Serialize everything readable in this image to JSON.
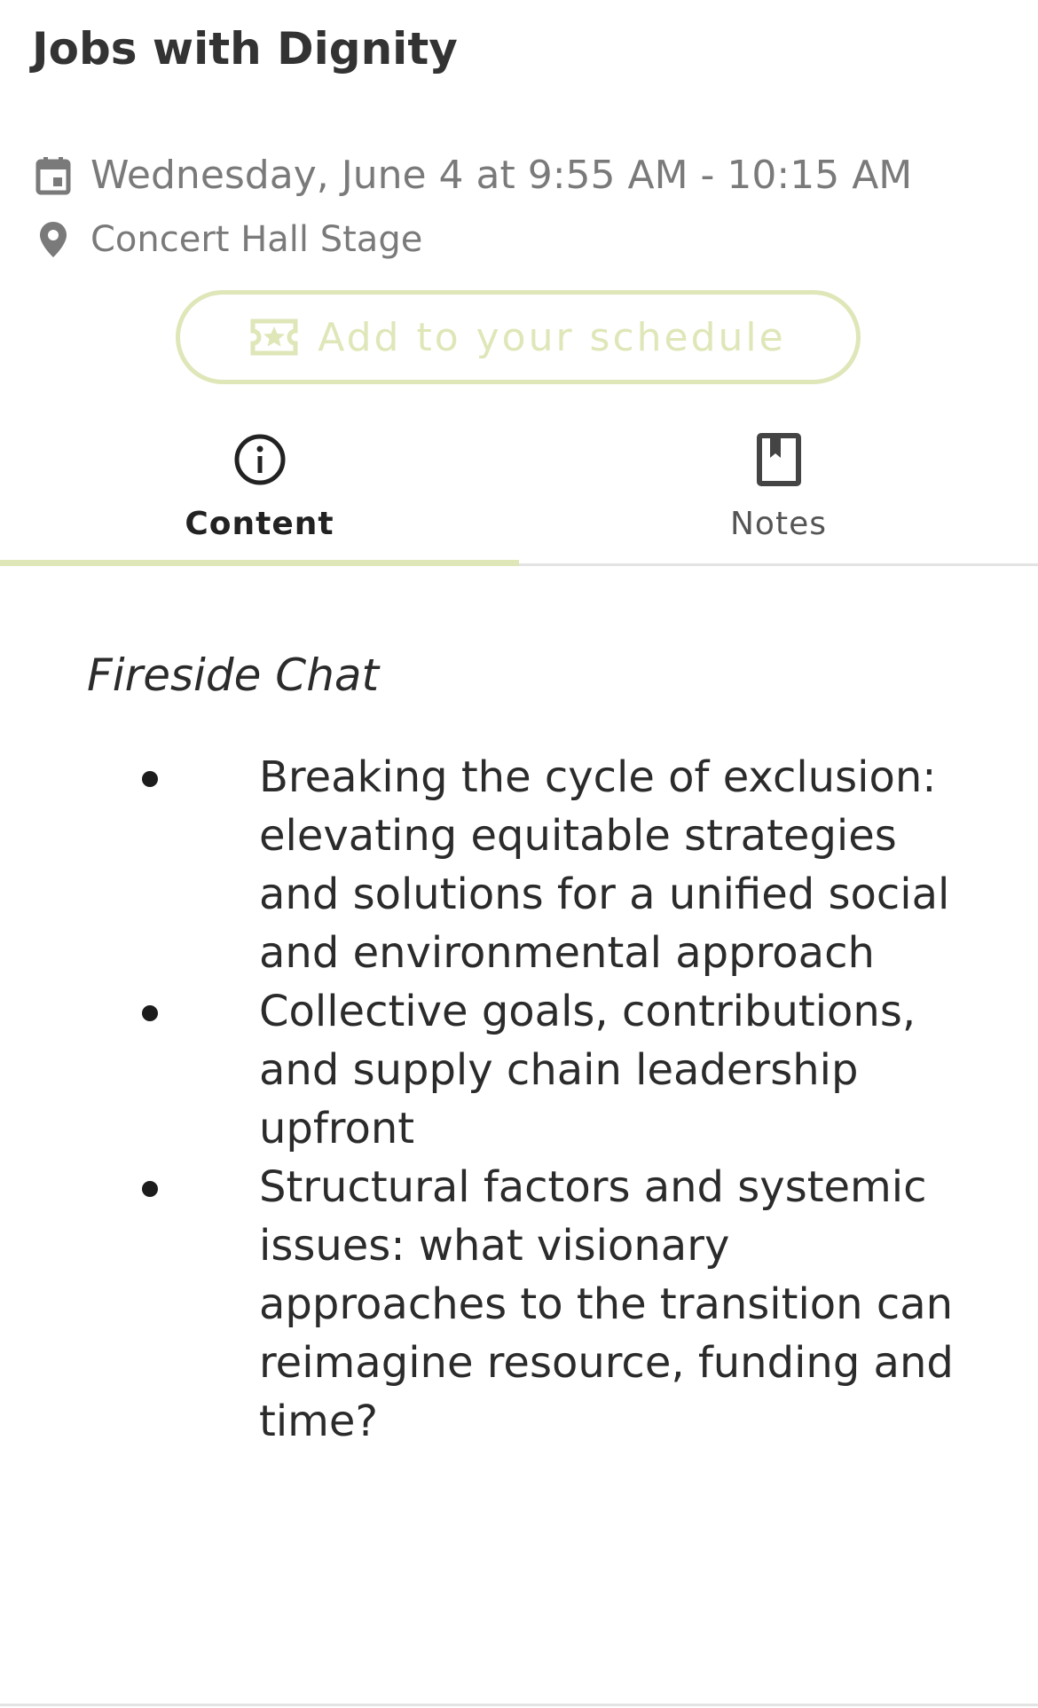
{
  "session": {
    "title": "Jobs with Dignity",
    "datetime": "Wednesday, June 4 at 9:55 AM - 10:15 AM",
    "location": "Concert Hall Stage",
    "add_button_label": "Add to your schedule"
  },
  "tabs": [
    {
      "label": "Content",
      "icon": "info-icon",
      "active": true
    },
    {
      "label": "Notes",
      "icon": "bookmark-icon",
      "active": false
    }
  ],
  "content": {
    "subtitle": "Fireside Chat",
    "bullets": [
      "Breaking the cycle of exclusion: elevating equitable strategies and solutions for a unified social and environmental approach",
      "Collective goals, contributions, and supply chain leadership upfront",
      "Structural factors and systemic issues: what visionary approaches to the transition can reimagine resource, funding and time?"
    ]
  },
  "colors": {
    "accent": "#dfe6b8",
    "meta_text": "#7a7a7a",
    "title_text": "#333333",
    "body_text": "#2b2b2b",
    "divider": "#e3e3e3"
  }
}
